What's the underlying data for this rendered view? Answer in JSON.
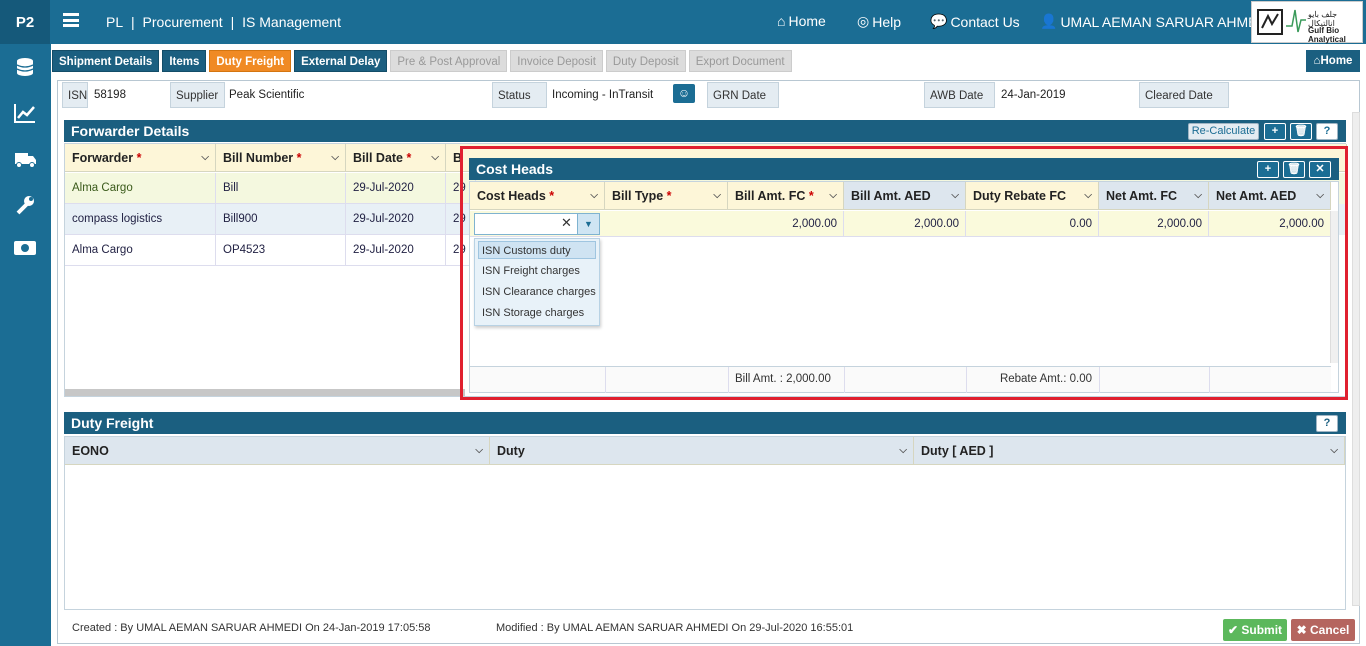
{
  "app": {
    "brand": "P2",
    "breadcrumb": [
      "PL",
      "|",
      "Procurement",
      "|",
      "IS Management"
    ]
  },
  "topnav": {
    "home": "Home",
    "help": "Help",
    "contact": "Contact Us",
    "user": "UMAL AEMAN SARUAR AHMEDI"
  },
  "logo": {
    "arabic": "جلف بايو انالتيكال",
    "english": "Gulf Bio Analytical"
  },
  "tabs": [
    {
      "label": "Shipment Details",
      "state": "normal"
    },
    {
      "label": "Items",
      "state": "normal"
    },
    {
      "label": "Duty Freight",
      "state": "active"
    },
    {
      "label": "External Delay",
      "state": "normal"
    },
    {
      "label": "Pre & Post Approval",
      "state": "disabled"
    },
    {
      "label": "Invoice Deposit",
      "state": "disabled"
    },
    {
      "label": "Duty Deposit",
      "state": "disabled"
    },
    {
      "label": "Export Document",
      "state": "disabled"
    }
  ],
  "home_button": "Home",
  "info": {
    "isn_label": "ISN",
    "isn": "58198",
    "supplier_label": "Supplier",
    "supplier": "Peak Scientific",
    "status_label": "Status",
    "status": "Incoming - InTransit",
    "grn_label": "GRN Date",
    "grn": "",
    "awb_label": "AWB Date",
    "awb": "24-Jan-2019",
    "cleared_label": "Cleared Date",
    "cleared": ""
  },
  "forwarder": {
    "title": "Forwarder Details",
    "recalc": "Re-Calculate",
    "columns": [
      "Forwarder",
      "Bill Number",
      "Bill Date",
      "B"
    ],
    "rows": [
      {
        "forwarder": "Alma Cargo",
        "bill": "Bill",
        "date": "29-Jul-2020",
        "b": "29"
      },
      {
        "forwarder": "compass logistics",
        "bill": "Bill900",
        "date": "29-Jul-2020",
        "b": "29"
      },
      {
        "forwarder": "Alma Cargo",
        "bill": "OP4523",
        "date": "29-Jul-2020",
        "b": "29"
      }
    ]
  },
  "cost": {
    "title": "Cost Heads",
    "columns": [
      "Cost Heads",
      "Bill Type",
      "Bill Amt. FC",
      "Bill Amt. AED",
      "Duty Rebate FC",
      "Net Amt. FC",
      "Net Amt. AED"
    ],
    "row": {
      "input": "",
      "bill_fc": "2,000.00",
      "bill_aed": "2,000.00",
      "rebate": "0.00",
      "net_fc": "2,000.00",
      "net_aed": "2,000.00"
    },
    "options": [
      "ISN Customs duty",
      "ISN Freight charges",
      "ISN Clearance charges",
      "ISN Storage charges"
    ],
    "footer_bill": "Bill Amt. : 2,000.00",
    "footer_rebate": "Rebate Amt.: 0.00"
  },
  "duty": {
    "title": "Duty Freight",
    "columns": [
      "EONO",
      "Duty",
      "Duty [ AED ]"
    ]
  },
  "footer": {
    "created": "Created : By UMAL AEMAN SARUAR AHMEDI On 24-Jan-2019 17:05:58",
    "modified": "Modified : By UMAL AEMAN SARUAR AHMEDI On 29-Jul-2020 16:55:01",
    "submit": "Submit",
    "cancel": "Cancel"
  },
  "colors": {
    "primary": "#1b5f80",
    "accent": "#f08a24",
    "submit": "#5cb85c",
    "cancel": "#b5655f",
    "highlight": "#e02030"
  }
}
